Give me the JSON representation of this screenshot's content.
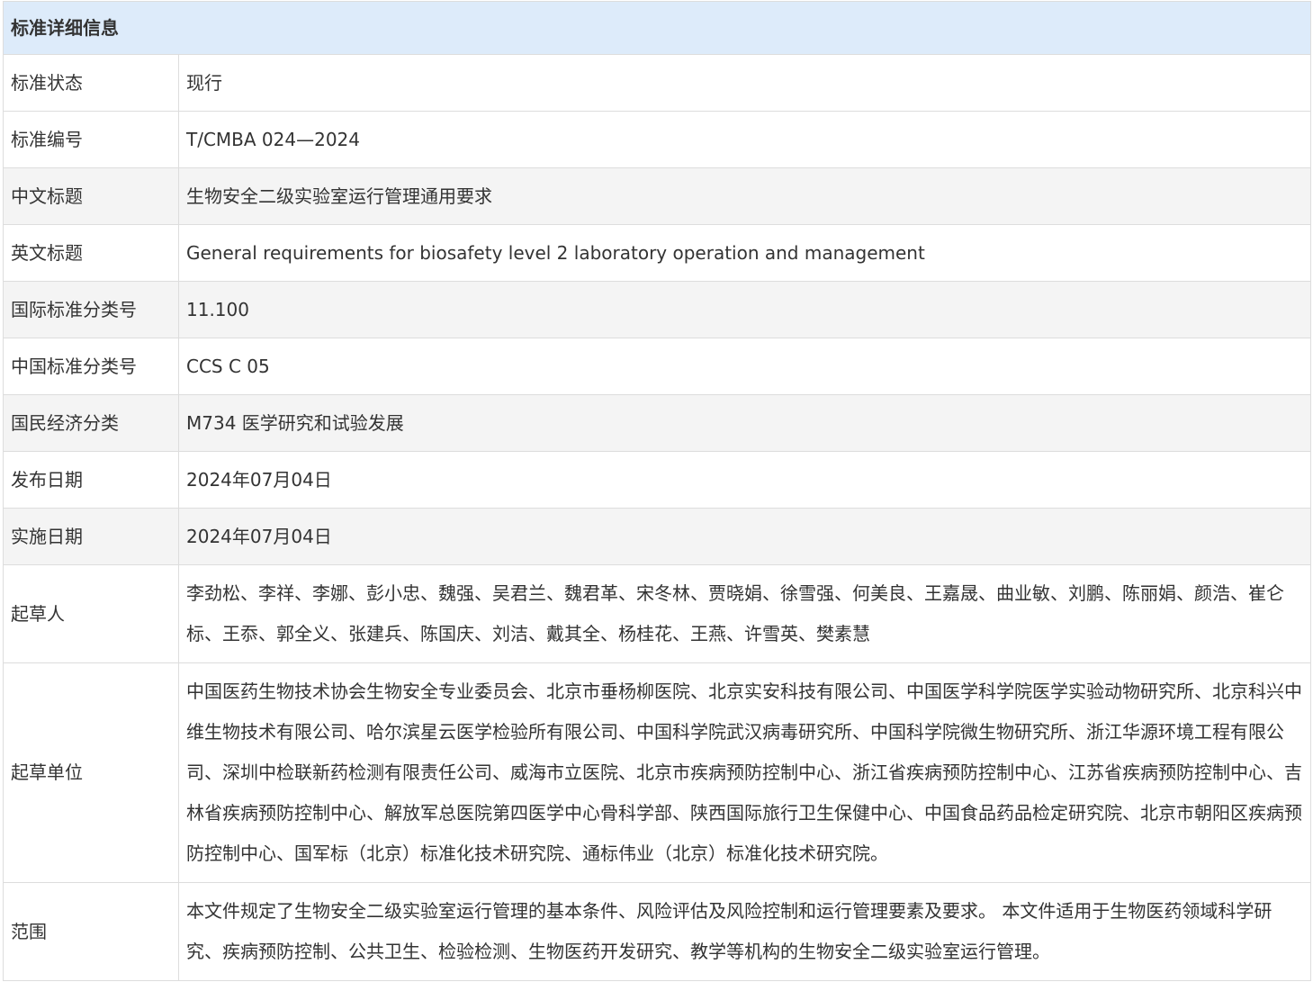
{
  "header": {
    "title": "标准详细信息"
  },
  "rows": [
    {
      "label": "标准状态",
      "value": "现行"
    },
    {
      "label": "标准编号",
      "value": "T/CMBA 024—2024"
    },
    {
      "label": "中文标题",
      "value": "生物安全二级实验室运行管理通用要求"
    },
    {
      "label": "英文标题",
      "value": "General requirements for biosafety level 2 laboratory operation and management"
    },
    {
      "label": "国际标准分类号",
      "value": "11.100"
    },
    {
      "label": "中国标准分类号",
      "value": "CCS C 05"
    },
    {
      "label": "国民经济分类",
      "value": "M734 医学研究和试验发展"
    },
    {
      "label": "发布日期",
      "value": "2024年07月04日"
    },
    {
      "label": "实施日期",
      "value": "2024年07月04日"
    },
    {
      "label": "起草人",
      "value": "李劲松、李祥、李娜、彭小忠、魏强、吴君兰、魏君革、宋冬林、贾晓娟、徐雪强、何美良、王嘉晟、曲业敏、刘鹏、陈丽娟、颜浩、崔仑标、王忝、郭全义、张建兵、陈国庆、刘洁、戴其全、杨桂花、王燕、许雪英、樊素慧"
    },
    {
      "label": "起草单位",
      "value": "中国医药生物技术协会生物安全专业委员会、北京市垂杨柳医院、北京实安科技有限公司、中国医学科学院医学实验动物研究所、北京科兴中维生物技术有限公司、哈尔滨星云医学检验所有限公司、中国科学院武汉病毒研究所、中国科学院微生物研究所、浙江华源环境工程有限公司、深圳中检联新药检测有限责任公司、威海市立医院、北京市疾病预防控制中心、浙江省疾病预防控制中心、江苏省疾病预防控制中心、吉林省疾病预防控制中心、解放军总医院第四医学中心骨科学部、陕西国际旅行卫生保健中心、中国食品药品检定研究院、北京市朝阳区疾病预防控制中心、国军标（北京）标准化技术研究院、通标伟业（北京）标准化技术研究院。"
    },
    {
      "label": "范围",
      "value": "本文件规定了生物安全二级实验室运行管理的基本条件、风险评估及风险控制和运行管理要素及要求。 本文件适用于生物医药领域科学研究、疾病预防控制、公共卫生、检验检测、生物医药开发研究、教学等机构的生物安全二级实验室运行管理。"
    }
  ]
}
